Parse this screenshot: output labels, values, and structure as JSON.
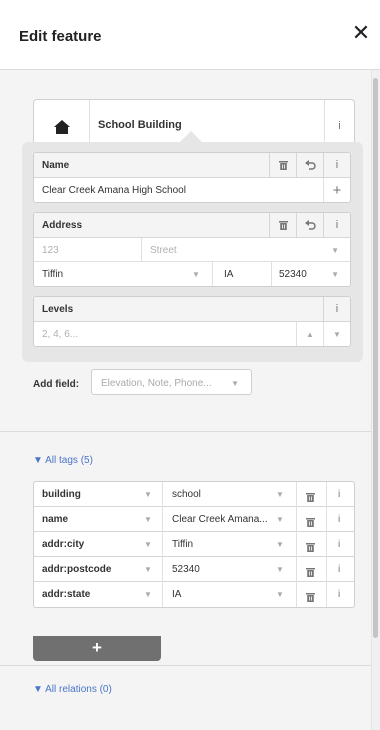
{
  "header": {
    "title": "Edit feature",
    "close_label": "✕"
  },
  "preset": {
    "name": "School Building",
    "info_label": "i"
  },
  "fields": {
    "name": {
      "label": "Name",
      "value": "Clear Creek Amana High School",
      "add_label": "+"
    },
    "address": {
      "label": "Address",
      "housenumber_placeholder": "123",
      "street_placeholder": "Street",
      "city": "Tiffin",
      "state": "IA",
      "postcode": "52340"
    },
    "levels": {
      "label": "Levels",
      "placeholder": "2, 4, 6..."
    }
  },
  "add_field": {
    "label": "Add field:",
    "placeholder": "Elevation, Note, Phone..."
  },
  "all_tags": {
    "toggle_label": "▼ All tags (5)",
    "rows": [
      {
        "key": "building",
        "value": "school"
      },
      {
        "key": "name",
        "value": "Clear Creek Amana..."
      },
      {
        "key": "addr:city",
        "value": "Tiffin"
      },
      {
        "key": "addr:postcode",
        "value": "52340"
      },
      {
        "key": "addr:state",
        "value": "IA"
      }
    ],
    "add_label": "+"
  },
  "all_relations": {
    "toggle_label": "▼ All relations (0)"
  },
  "icons": {
    "close": "close-icon",
    "preset": "home-icon",
    "delete": "trash-icon",
    "revert": "undo-icon",
    "info": "info-icon",
    "dropdown": "chevron-down-icon"
  }
}
